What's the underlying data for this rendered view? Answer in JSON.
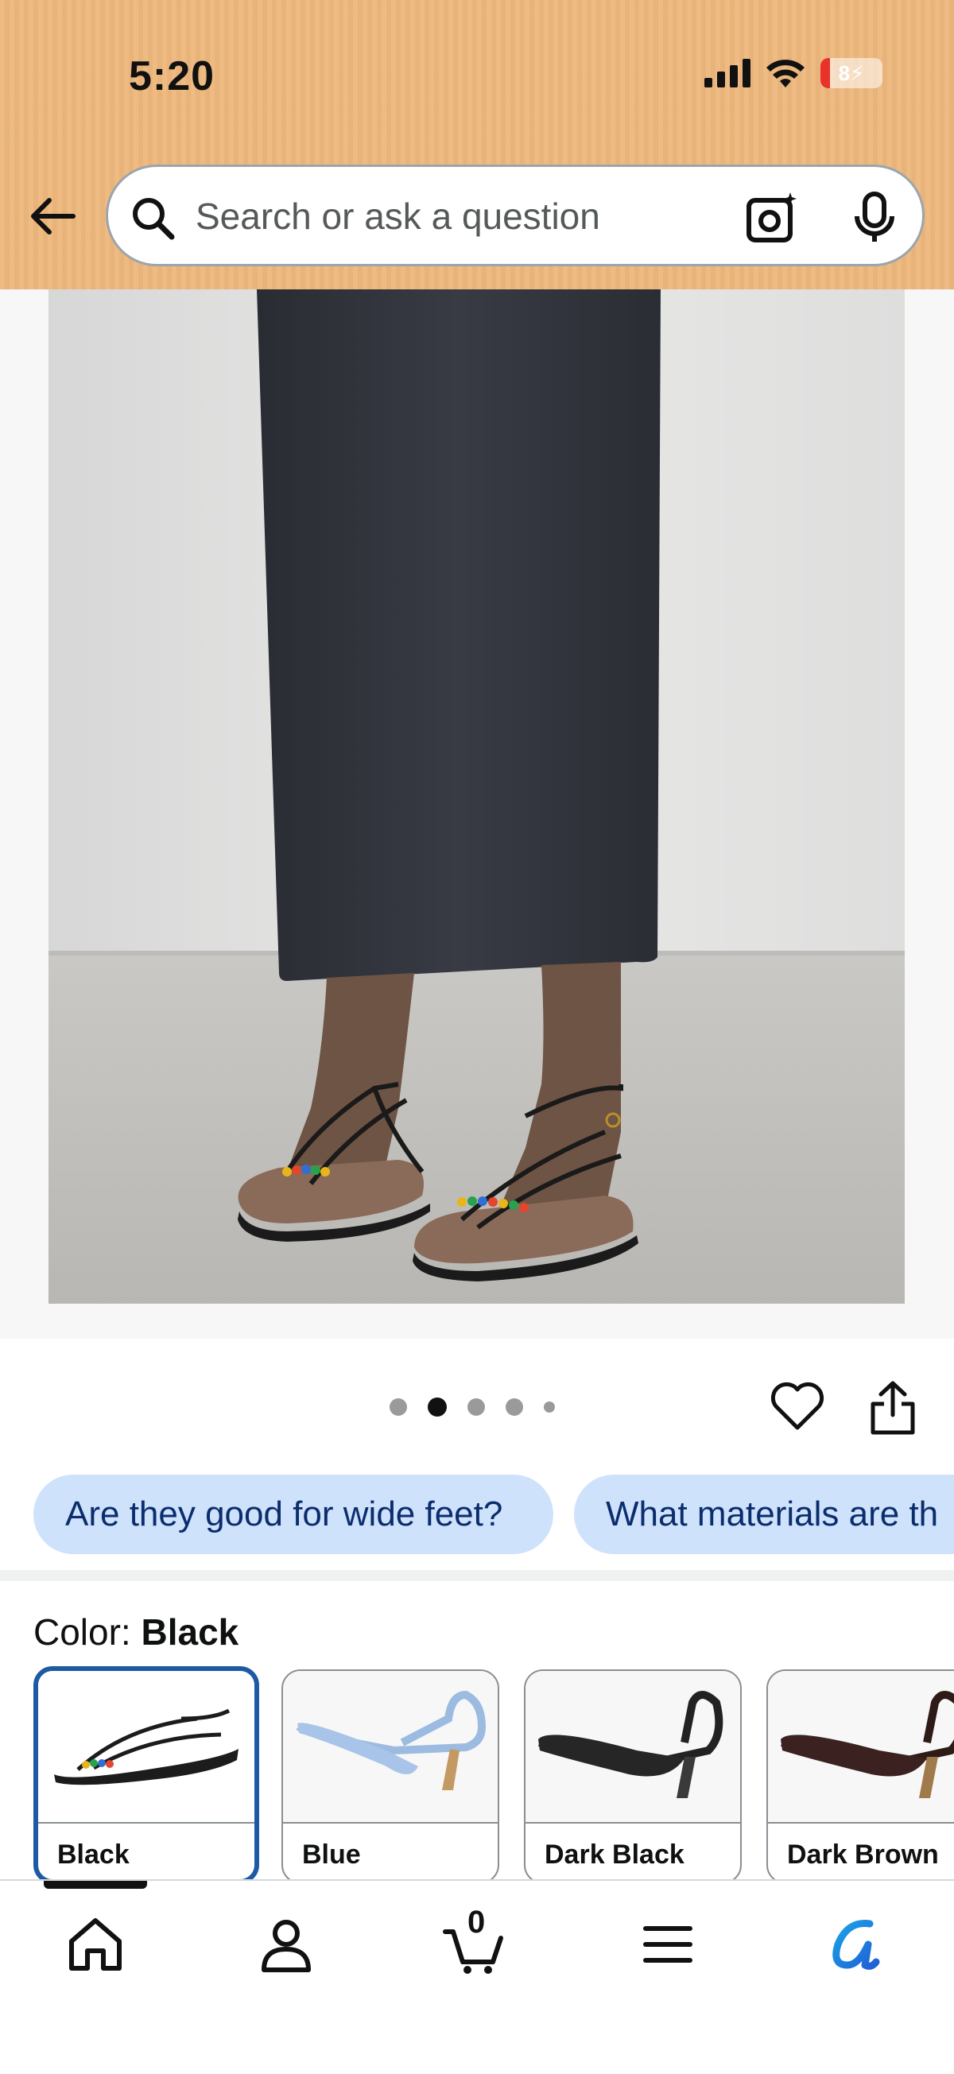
{
  "status_bar": {
    "time": "5:20",
    "battery": "8"
  },
  "header": {
    "search_placeholder": "Search or ask a question"
  },
  "gallery": {
    "dots_total": 5,
    "active_dot": 2
  },
  "suggestions": [
    "Are they good for wide feet?",
    "What materials are th"
  ],
  "color": {
    "label": "Color: ",
    "selected": "Black"
  },
  "swatches": [
    {
      "name": "Black",
      "selected": true
    },
    {
      "name": "Blue",
      "selected": false
    },
    {
      "name": "Dark Black",
      "selected": false
    },
    {
      "name": "Dark Brown",
      "selected": false
    }
  ],
  "bottom_nav": {
    "cart_count": "0"
  },
  "colors": {
    "header_bg": "#edb77c",
    "chip_bg": "#cfe2fb",
    "selected_border": "#1d5aa4"
  }
}
